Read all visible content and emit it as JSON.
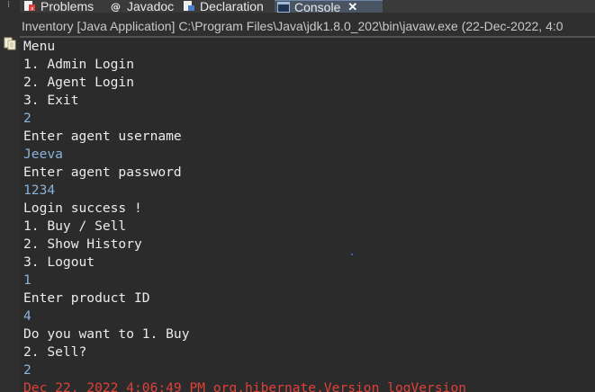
{
  "tabs": [
    {
      "label": "Problems",
      "icon": "problems-icon"
    },
    {
      "label": "Javadoc",
      "icon": "javadoc-icon"
    },
    {
      "label": "Declaration",
      "icon": "declaration-icon"
    },
    {
      "label": "Console",
      "icon": "console-icon",
      "active": true,
      "close": "✕"
    }
  ],
  "console": {
    "header": "Inventory [Java Application] C:\\Program Files\\Java\\jdk1.8.0_202\\bin\\javaw.exe  (22-Dec-2022, 4:0",
    "lines": [
      {
        "text": "Menu",
        "kind": "out"
      },
      {
        "text": "1. Admin Login",
        "kind": "out"
      },
      {
        "text": "2. Agent Login",
        "kind": "out"
      },
      {
        "text": "3. Exit",
        "kind": "out"
      },
      {
        "text": "2",
        "kind": "input"
      },
      {
        "text": "Enter agent username",
        "kind": "out"
      },
      {
        "text": "Jeeva",
        "kind": "input"
      },
      {
        "text": "Enter agent password",
        "kind": "out"
      },
      {
        "text": "1234",
        "kind": "input"
      },
      {
        "text": "Login success !",
        "kind": "out"
      },
      {
        "text": "1. Buy / Sell",
        "kind": "out"
      },
      {
        "text": "2. Show History",
        "kind": "out"
      },
      {
        "text": "3. Logout",
        "kind": "out"
      },
      {
        "text": "1",
        "kind": "input"
      },
      {
        "text": "Enter product ID",
        "kind": "out"
      },
      {
        "text": "4",
        "kind": "input"
      },
      {
        "text": "Do you want to 1. Buy",
        "kind": "out"
      },
      {
        "text": "2. Sell?",
        "kind": "out"
      },
      {
        "text": "2",
        "kind": "input"
      },
      {
        "text": "Dec 22, 2022 4:06:49 PM org.hibernate.Version logVersion",
        "kind": "err"
      }
    ]
  },
  "colors": {
    "output_text": "#ebebeb",
    "input_text": "#8ab3d8",
    "error_text": "#e0403a",
    "background": "#2b2b2b",
    "active_tab": "#4a5563"
  }
}
